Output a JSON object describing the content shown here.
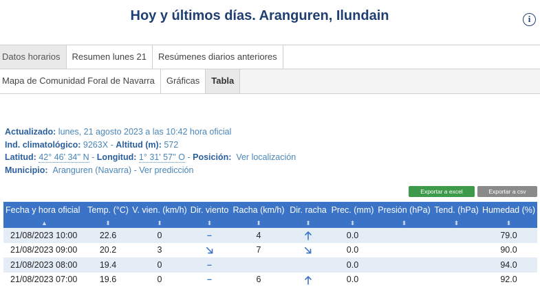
{
  "header": {
    "title": "Hoy y últimos días. Aranguren, Ilundain",
    "info_icon": "info-icon"
  },
  "tabs_row1": [
    {
      "label": "Datos horarios",
      "active": true
    },
    {
      "label": "Resumen lunes 21",
      "active": false
    },
    {
      "label": "Resúmenes diarios anteriores",
      "active": false
    }
  ],
  "tabs_row2": [
    {
      "label": "Mapa de Comunidad Foral de Navarra",
      "active": false
    },
    {
      "label": "Gráficas",
      "active": false
    },
    {
      "label": "Tabla",
      "active": true
    }
  ],
  "meta": {
    "updated_label": "Actualizado:",
    "updated_value": "lunes, 21 agosto 2023 a las 10:42 hora oficial",
    "climate_label": "Ind. climatológico",
    "climate_value": "9263X",
    "altitude_label": "Altitud (m)",
    "altitude_value": "572",
    "latitude_label": "Latitud",
    "latitude_value": "42° 46' 34'' N",
    "longitude_label": "Longitud",
    "longitude_value": "1° 31' 57'' O",
    "position_label": "Posición",
    "position_link": "Ver localización",
    "municipio_label": "Municipio",
    "municipio_value": "Aranguren (Navarra)",
    "prediction_link": "Ver predicción"
  },
  "export": {
    "excel_label": "Exportar a excel",
    "csv_label": "Exportar a csv",
    "excel_color": "#3c9a4a",
    "csv_color": "#8a8a8a"
  },
  "table": {
    "header_color": "#3b73c6",
    "columns": [
      "Fecha y hora oficial",
      "Temp. (°C)",
      "V. vien. (km/h)",
      "Dir. viento",
      "Racha (km/h)",
      "Dir. racha",
      "Prec. (mm)",
      "Presión (hPa)",
      "Tend. (hPa)",
      "Humedad (%)"
    ],
    "sort_marks": [
      "▲",
      "⬍",
      "⬍",
      "⬍",
      "⬍",
      "⬍",
      "⬍",
      "⬍",
      "⬍",
      "⬍"
    ],
    "rows": [
      {
        "fecha": "21/08/2023 10:00",
        "temp": "22.6",
        "vien": "0",
        "dir_viento": "calm",
        "racha": "4",
        "dir_racha": "north",
        "prec": "0.0",
        "presion": "",
        "tend": "",
        "humedad": "79.0"
      },
      {
        "fecha": "21/08/2023 09:00",
        "temp": "20.2",
        "vien": "3",
        "dir_viento": "northwest",
        "racha": "7",
        "dir_racha": "northwest",
        "prec": "0.0",
        "presion": "",
        "tend": "",
        "humedad": "90.0"
      },
      {
        "fecha": "21/08/2023 08:00",
        "temp": "19.4",
        "vien": "0",
        "dir_viento": "calm",
        "racha": "",
        "dir_racha": "",
        "prec": "0.0",
        "presion": "",
        "tend": "",
        "humedad": "94.0"
      },
      {
        "fecha": "21/08/2023 07:00",
        "temp": "19.6",
        "vien": "0",
        "dir_viento": "calm",
        "racha": "6",
        "dir_racha": "north",
        "prec": "0.0",
        "presion": "",
        "tend": "",
        "humedad": "92.0"
      }
    ]
  }
}
